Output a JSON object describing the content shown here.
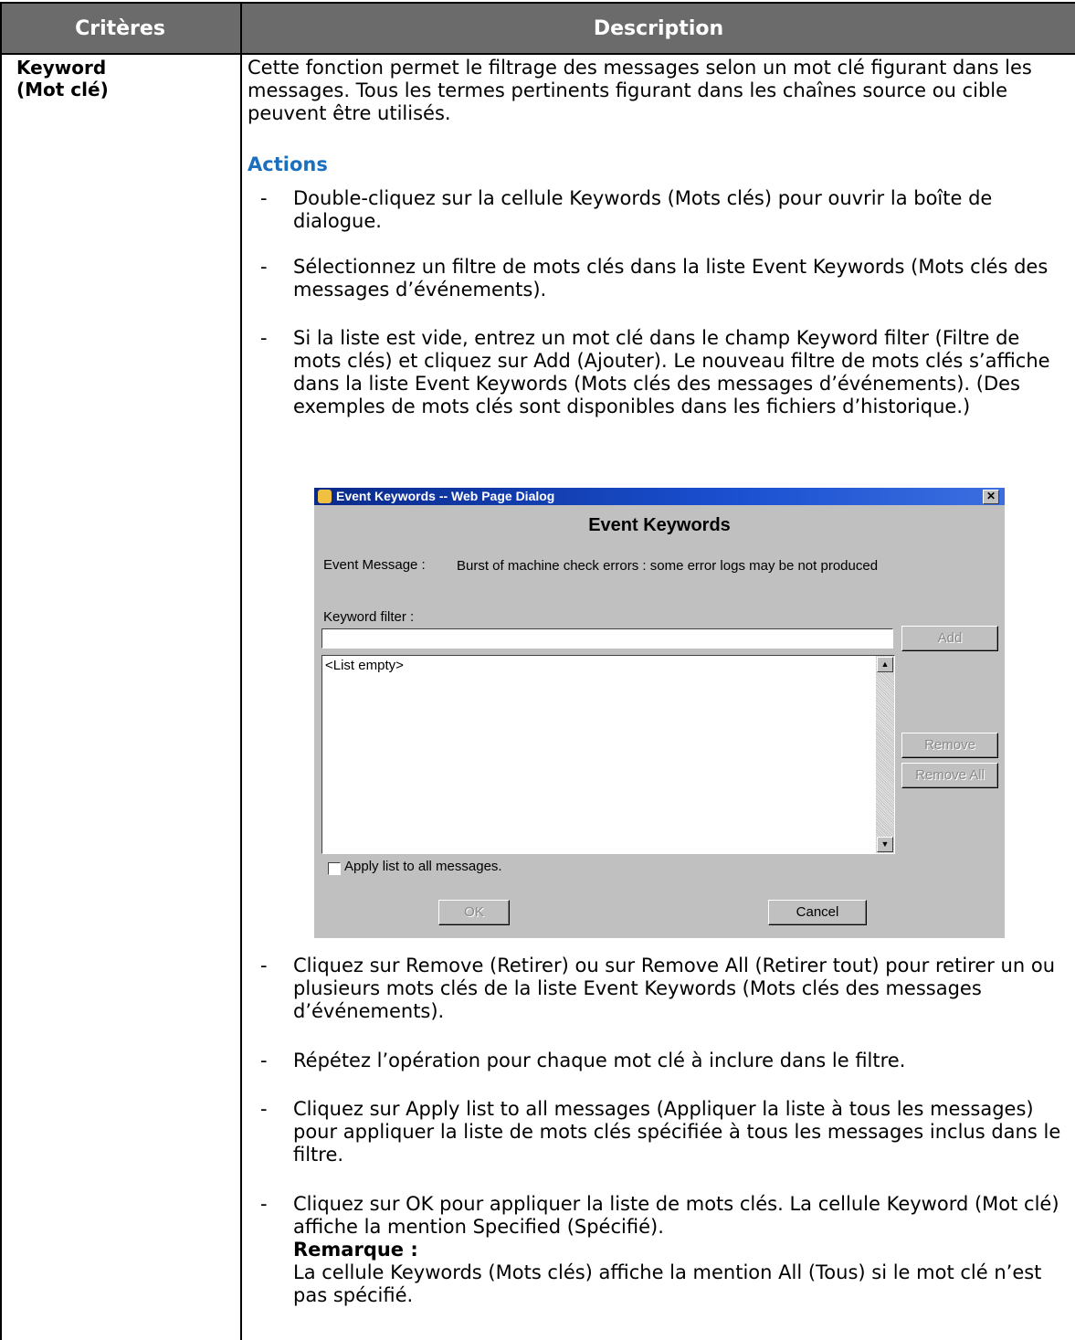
{
  "table": {
    "headers": [
      "Critères",
      "Description"
    ],
    "criteria": [
      "Keyword",
      "(Mot clé)"
    ]
  },
  "intro": "Cette fonction permet le filtrage des messages selon un mot clé figurant dans les messages. Tous les termes pertinents figurant dans les chaînes source ou cible peuvent être utilisés.",
  "actions_heading": "Actions",
  "steps_before": [
    "Double-cliquez sur la cellule Keywords (Mots clés) pour ouvrir la boîte de dialogue.",
    "Sélectionnez un filtre de mots clés dans la liste Event Keywords (Mots clés des messages d’événements).",
    "Si la liste est vide, entrez un mot clé dans le champ Keyword filter (Filtre de mots clés) et cliquez sur Add (Ajouter). Le nouveau filtre de mots clés s’affiche dans la liste Event Keywords (Mots clés des messages d’événements). (Des exemples de mots clés sont disponibles dans les fichiers d’historique.)"
  ],
  "dialog": {
    "title": "Event Keywords -- Web Page Dialog",
    "heading": "Event Keywords",
    "message_label": "Event Message :",
    "message_value": "Burst of machine check errors : some error logs may be not produced",
    "keyword_filter_label": "Keyword filter :",
    "keyword_filter_value": "",
    "list_empty": "<List empty>",
    "add_button": "Add",
    "remove_button": "Remove",
    "remove_all_button": "Remove All",
    "apply_checkbox_label": "Apply list to all messages.",
    "ok_button": "OK",
    "cancel_button": "Cancel"
  },
  "steps_after": [
    "Cliquez sur Remove (Retirer) ou sur Remove All (Retirer tout) pour retirer un ou plusieurs mots clés de la liste Event Keywords (Mots clés des messages d’événements).",
    "Répétez l’opération pour chaque mot clé à inclure dans le filtre.",
    "Cliquez sur Apply list to all messages (Appliquer la liste à tous les messages) pour appliquer la liste de mots clés spécifiée à tous les messages inclus dans le filtre.",
    "Cliquez sur OK pour appliquer la liste de mots clés. La cellule Keyword (Mot clé) affiche la mention Specified (Spécifié)."
  ],
  "note_label": "Remarque :",
  "note_text": "La cellule Keywords (Mots clés) affiche la mention All (Tous) si le mot clé n’est pas spécifié.",
  "bullet_char": "-"
}
